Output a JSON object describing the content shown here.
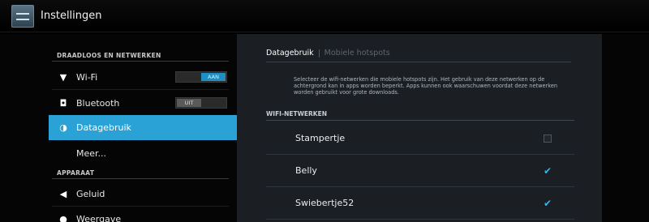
{
  "window": {
    "title": "Instellingen"
  },
  "sidebar": {
    "sections": [
      {
        "header": "DRAADLOOS EN NETWERKEN"
      },
      {
        "header": "APPARAAT"
      }
    ],
    "items": [
      {
        "label": "Wi-Fi",
        "icon": "wifi-icon",
        "toggle": "AAN",
        "toggle_state": "on"
      },
      {
        "label": "Bluetooth",
        "icon": "bluetooth-icon",
        "toggle": "UIT",
        "toggle_state": "off"
      },
      {
        "label": "Datagebruik",
        "icon": "data-usage-icon",
        "selected": true
      },
      {
        "label": "Meer..."
      },
      {
        "label": "Geluid",
        "icon": "sound-icon"
      },
      {
        "label": "Weergave",
        "icon": "display-icon"
      }
    ]
  },
  "main": {
    "tabs": [
      {
        "label": "Datagebruik",
        "active": true
      },
      {
        "label": "Mobiele hotspots",
        "active": false
      }
    ],
    "description": "Selecteer de wifi-netwerken die mobiele hotspots zijn. Het gebruik van deze netwerken op de achtergrond kan in apps worden beperkt. Apps kunnen ook waarschuwen voordat deze netwerken worden gebruikt voor grote downloads.",
    "networks_header": "WIFI-NETWERKEN",
    "networks": [
      {
        "name": "Stampertje",
        "checked": false
      },
      {
        "name": "Belly",
        "checked": true
      },
      {
        "name": "Swiebertje52",
        "checked": true
      }
    ]
  },
  "colors": {
    "accent": "#2aa2d6",
    "check": "#35b4ea"
  }
}
